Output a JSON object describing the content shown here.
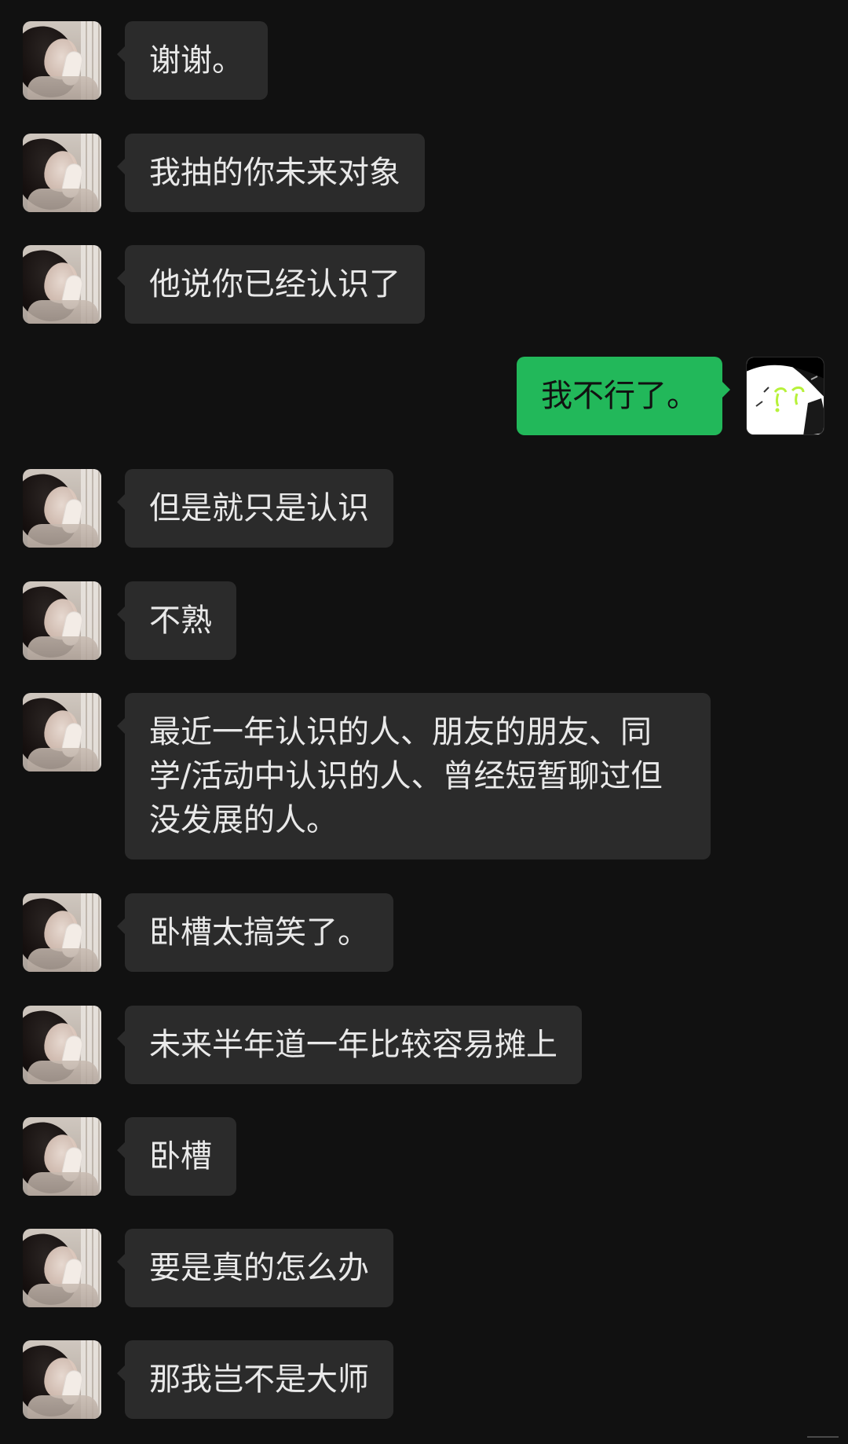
{
  "conversation": {
    "messages": [
      {
        "side": "left",
        "text": "谢谢。"
      },
      {
        "side": "left",
        "text": "我抽的你未来对象"
      },
      {
        "side": "left",
        "text": "他说你已经认识了"
      },
      {
        "side": "right",
        "text": "我不行了。"
      },
      {
        "side": "left",
        "text": "但是就只是认识"
      },
      {
        "side": "left",
        "text": "不熟"
      },
      {
        "side": "left",
        "text": "最近一年认识的人、朋友的朋友、同学/活动中认识的人、曾经短暂聊过但没发展的人。"
      },
      {
        "side": "left",
        "text": "卧槽太搞笑了。"
      },
      {
        "side": "left",
        "text": "未来半年道一年比较容易摊上"
      },
      {
        "side": "left",
        "text": "卧槽"
      },
      {
        "side": "left",
        "text": "要是真的怎么办"
      },
      {
        "side": "left",
        "text": "那我岂不是大师"
      }
    ]
  },
  "theme": {
    "background": "#111111",
    "incoming_bubble": "#2b2b2b",
    "outgoing_bubble": "#22b85a"
  },
  "icons": {
    "contact_avatar": "contact-avatar",
    "self_avatar": "self-avatar"
  }
}
